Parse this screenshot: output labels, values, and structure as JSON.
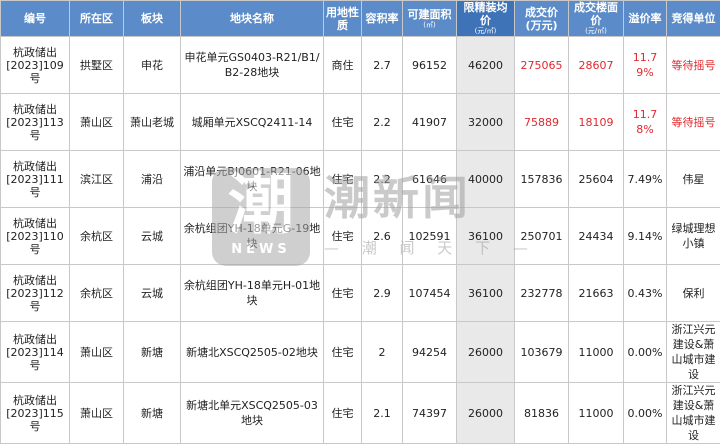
{
  "table": {
    "headers": {
      "code": "编号",
      "district": "所在区",
      "sector": "板块",
      "parcel": "地块名称",
      "use_l1": "用地性",
      "use_l2": "质",
      "far": "容积率",
      "area": "可建面积",
      "area_unit": "(㎡)",
      "price_limit": "限精装均价",
      "price_limit_unit": "(元/㎡)",
      "deal_l1": "成交价",
      "deal_l2": "(万元)",
      "floor_l1": "成交楼面",
      "floor_l2": "价",
      "floor_unit": "(元/㎡)",
      "premium": "溢价率",
      "winner": "竞得单位"
    },
    "rows": [
      {
        "code_l1": "杭政储出",
        "code_l2": "[2023]109号",
        "district": "拱墅区",
        "sector": "申花",
        "parcel": "申花单元GS0403-R21/B1/B2-28地块",
        "use": "商住",
        "far": "2.7",
        "area": "96152",
        "price_limit": "46200",
        "deal": "275065",
        "floor": "28607",
        "premium": "11.79%",
        "winner": "等待摇号"
      },
      {
        "code_l1": "杭政储出",
        "code_l2": "[2023]113号",
        "district": "萧山区",
        "sector": "萧山老城",
        "parcel": "城厢单元XSCQ2411-14",
        "use": "住宅",
        "far": "2.2",
        "area": "41907",
        "price_limit": "32000",
        "deal": "75889",
        "floor": "18109",
        "premium": "11.78%",
        "winner": "等待摇号"
      },
      {
        "code_l1": "杭政储出",
        "code_l2": "[2023]111号",
        "district": "滨江区",
        "sector": "浦沿",
        "parcel": "浦沿单元BJ0601-R21-06地块",
        "use": "住宅",
        "far": "2.2",
        "area": "61646",
        "price_limit": "40000",
        "deal": "157836",
        "floor": "25604",
        "premium": "7.49%",
        "winner": "伟星"
      },
      {
        "code_l1": "杭政储出",
        "code_l2": "[2023]110号",
        "district": "余杭区",
        "sector": "云城",
        "parcel": "余杭组团YH-18单元G-19地块",
        "use": "住宅",
        "far": "2.6",
        "area": "102591",
        "price_limit": "36100",
        "deal": "250701",
        "floor": "24434",
        "premium": "9.14%",
        "winner": "绿城理想小镇"
      },
      {
        "code_l1": "杭政储出",
        "code_l2": "[2023]112号",
        "district": "余杭区",
        "sector": "云城",
        "parcel": "余杭组团YH-18单元H-01地块",
        "use": "住宅",
        "far": "2.9",
        "area": "107454",
        "price_limit": "36100",
        "deal": "232778",
        "floor": "21663",
        "premium": "0.43%",
        "winner": "保利"
      },
      {
        "code_l1": "杭政储出",
        "code_l2": "[2023]114号",
        "district": "萧山区",
        "sector": "新塘",
        "parcel": "新塘北XSCQ2505-02地块",
        "use": "住宅",
        "far": "2",
        "area": "94254",
        "price_limit": "26000",
        "deal": "103679",
        "floor": "11000",
        "premium": "0.00%",
        "winner": "浙江兴元建设&萧山城市建设"
      },
      {
        "code_l1": "杭政储出",
        "code_l2": "[2023]115号",
        "district": "萧山区",
        "sector": "新塘",
        "parcel": "新塘北单元XSCQ2505-03地块",
        "use": "住宅",
        "far": "2.1",
        "area": "74397",
        "price_limit": "26000",
        "deal": "81836",
        "floor": "11000",
        "premium": "0.00%",
        "winner": "浙江兴元建设&萧山城市建设"
      }
    ],
    "highlight_colors": {
      "header": "#5b8cc9",
      "header_hl": "#3f73b8",
      "red_text": "#e0282e",
      "hl_column_bg": "#e9e9e9"
    }
  },
  "watermark": {
    "badge_char": "潮",
    "badge_text": "NEWS",
    "title": "潮新闻",
    "subtitle": "— 潮 闻 天 下 —"
  }
}
